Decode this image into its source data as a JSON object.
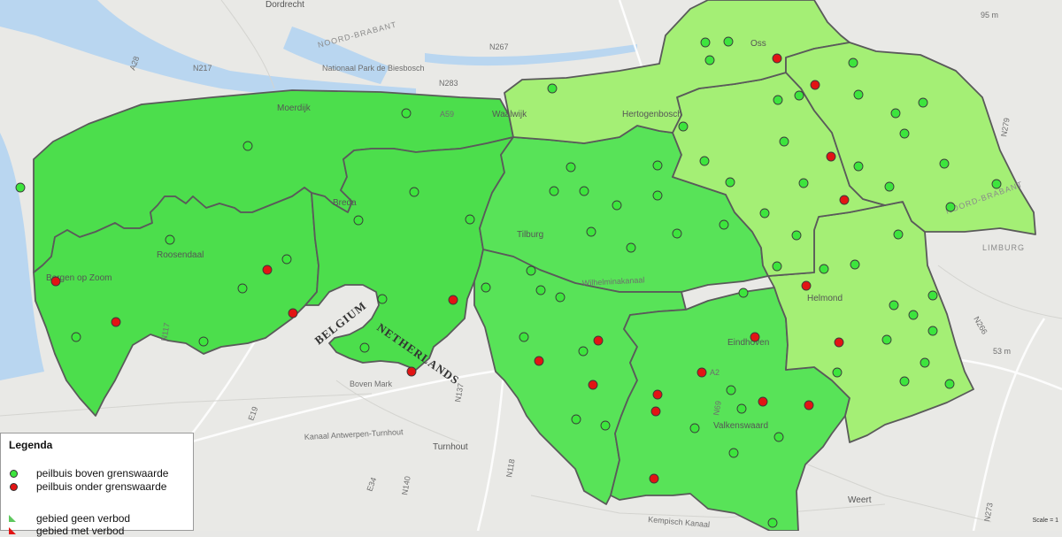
{
  "colors": {
    "green_dark": "#4cde4c",
    "green_mid": "#58e358",
    "green_light": "#a4ef75",
    "border": "#5a5a5a",
    "point_above": "#3de53d",
    "point_below": "#e21414",
    "water": "#b9d6f0"
  },
  "map_labels": {
    "dordrecht": "Dordrecht",
    "n217": "N217",
    "noord_brabant_top": "NOORD-BRABANT",
    "biesbosch": "Nationaal Park de Biesbosch",
    "n267": "N267",
    "n283": "N283",
    "oss": "Oss",
    "moerdijk": "Moerdijk",
    "a59": "A59",
    "waalwijk": "Waalwijk",
    "hertogenbosch": "Hertogenbosch",
    "breda": "Breda",
    "tilburg": "Tilburg",
    "roosendaal": "Roosendaal",
    "bergen_op_zoom": "Bergen op Zoom",
    "belgium": "BELGIUM",
    "netherlands": "NETHERLANDS",
    "eindhoven": "Eindhoven",
    "helmond": "Helmond",
    "valkenswaard": "Valkenswaard",
    "turnhout": "Turnhout",
    "weert": "Weert",
    "limburg": "LIMBURG",
    "noord_brabant_right": "NOORD-BRABANT",
    "a2": "A2",
    "e19": "E19",
    "e34": "E34",
    "n117": "N117",
    "n118": "N118",
    "n140": "N140",
    "n137": "N137",
    "n266": "N266",
    "n273": "N273",
    "m95": "95 m",
    "m53": "53 m",
    "boven_mark": "Boven Mark",
    "kanaal_antwerpen": "Kanaal Antwerpen-Turnhout",
    "kempisch_kanaal": "Kempisch Kanaal",
    "wilhelminakanaal": "Wilhelminakanaal",
    "a28": "A28",
    "n279": "N279",
    "n69": "N69"
  },
  "legend": {
    "title": "Legenda",
    "items": [
      {
        "label": "peilbuis boven grenswaarde",
        "color": "#3de53d",
        "symbol": "circle"
      },
      {
        "label": "peilbuis onder grenswaarde",
        "color": "#e21414",
        "symbol": "circle"
      },
      {
        "label": "gebied geen verbod",
        "color": "#5ec85e",
        "symbol": "triangle"
      },
      {
        "label": "gebied met verbod",
        "color": "#e21414",
        "symbol": "triangle"
      }
    ]
  },
  "scale_text": "Scale = 1",
  "wells_above": [
    [
      23,
      212
    ],
    [
      280,
      165
    ],
    [
      192,
      271
    ],
    [
      324,
      293
    ],
    [
      274,
      326
    ],
    [
      230,
      386
    ],
    [
      86,
      381
    ],
    [
      405,
      249
    ],
    [
      432,
      338
    ],
    [
      412,
      393
    ],
    [
      468,
      217
    ],
    [
      459,
      128
    ],
    [
      531,
      248
    ],
    [
      549,
      325
    ],
    [
      624,
      100
    ],
    [
      797,
      48
    ],
    [
      823,
      47
    ],
    [
      802,
      68
    ],
    [
      879,
      113
    ],
    [
      903,
      108
    ],
    [
      964,
      71
    ],
    [
      970,
      107
    ],
    [
      1043,
      116
    ],
    [
      1012,
      128
    ],
    [
      1022,
      151
    ],
    [
      1067,
      185
    ],
    [
      1126,
      208
    ],
    [
      1074,
      234
    ],
    [
      1005,
      211
    ],
    [
      970,
      188
    ],
    [
      886,
      160
    ],
    [
      772,
      143
    ],
    [
      796,
      182
    ],
    [
      825,
      206
    ],
    [
      908,
      207
    ],
    [
      864,
      241
    ],
    [
      900,
      266
    ],
    [
      1015,
      265
    ],
    [
      645,
      189
    ],
    [
      626,
      216
    ],
    [
      660,
      216
    ],
    [
      743,
      187
    ],
    [
      743,
      221
    ],
    [
      697,
      232
    ],
    [
      668,
      262
    ],
    [
      713,
      280
    ],
    [
      765,
      264
    ],
    [
      818,
      254
    ],
    [
      600,
      306
    ],
    [
      611,
      328
    ],
    [
      633,
      336
    ],
    [
      592,
      381
    ],
    [
      659,
      397
    ],
    [
      651,
      474
    ],
    [
      684,
      481
    ],
    [
      878,
      301
    ],
    [
      931,
      304
    ],
    [
      966,
      299
    ],
    [
      1054,
      334
    ],
    [
      1032,
      356
    ],
    [
      1054,
      374
    ],
    [
      1010,
      345
    ],
    [
      1002,
      384
    ],
    [
      1045,
      410
    ],
    [
      946,
      421
    ],
    [
      1022,
      431
    ],
    [
      1073,
      434
    ],
    [
      826,
      441
    ],
    [
      838,
      462
    ],
    [
      785,
      484
    ],
    [
      880,
      494
    ],
    [
      829,
      512
    ],
    [
      840,
      331
    ],
    [
      873,
      591
    ]
  ],
  "wells_below": [
    [
      63,
      318
    ],
    [
      131,
      364
    ],
    [
      302,
      305
    ],
    [
      331,
      354
    ],
    [
      465,
      420
    ],
    [
      512,
      339
    ],
    [
      878,
      66
    ],
    [
      921,
      96
    ],
    [
      939,
      177
    ],
    [
      954,
      226
    ],
    [
      911,
      323
    ],
    [
      948,
      387
    ],
    [
      853,
      381
    ],
    [
      676,
      385
    ],
    [
      609,
      408
    ],
    [
      670,
      435
    ],
    [
      793,
      421
    ],
    [
      743,
      446
    ],
    [
      741,
      465
    ],
    [
      862,
      454
    ],
    [
      914,
      458
    ],
    [
      739,
      541
    ]
  ]
}
